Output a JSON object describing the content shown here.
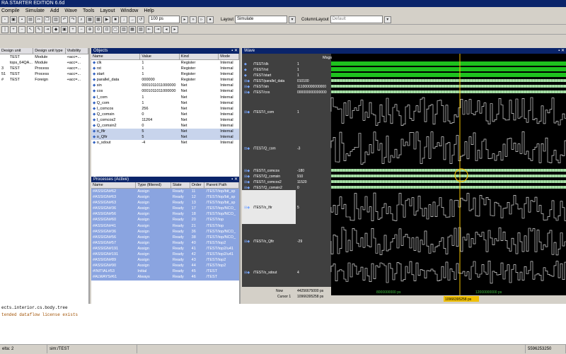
{
  "window": {
    "title": "RA STARTER EDITION 6.6d"
  },
  "menu": [
    "Compile",
    "Simulate",
    "Add",
    "Wave",
    "Tools",
    "Layout",
    "Window",
    "Help"
  ],
  "toolbar": {
    "sim_time": "100 ps",
    "layout_label": "Layout",
    "layout_value": "Simulate",
    "column_layout_label": "ColumnLayout",
    "column_layout_value": "Default"
  },
  "sim_panel": {
    "columns": [
      "Design unit",
      "Design unit type",
      "Visibility"
    ],
    "rows": [
      {
        "prefix": "",
        "unit": "TEST",
        "type": "Module",
        "vis": "+acc=..."
      },
      {
        "prefix": "",
        "unit": "tops_64QA...",
        "type": "Module",
        "vis": "+acc=..."
      },
      {
        "prefix": "3",
        "unit": "TEST",
        "type": "Process",
        "vis": "+acc=..."
      },
      {
        "prefix": "51",
        "unit": "TEST",
        "type": "Process",
        "vis": "+acc=..."
      },
      {
        "prefix": "#",
        "unit": "TEST",
        "type": "Foreign",
        "vis": "+acc=..."
      }
    ]
  },
  "objects": {
    "title": "Objects",
    "columns": [
      "Name",
      "Value",
      "Kind",
      "Mode"
    ],
    "rows": [
      {
        "name": "clk",
        "value": "1",
        "kind": "Register",
        "mode": "Internal"
      },
      {
        "name": "rst",
        "value": "1",
        "kind": "Register",
        "mode": "Internal"
      },
      {
        "name": "start",
        "value": "1",
        "kind": "Register",
        "mode": "Internal"
      },
      {
        "name": "parallel_data",
        "value": "000000",
        "kind": "Register",
        "mode": "Internal"
      },
      {
        "name": "sin",
        "value": "0001011011000000",
        "kind": "Net",
        "mode": "Internal"
      },
      {
        "name": "cos",
        "value": "0001011011000000",
        "kind": "Net",
        "mode": "Internal"
      },
      {
        "name": "I_com",
        "value": "1",
        "kind": "Net",
        "mode": "Internal"
      },
      {
        "name": "Q_com",
        "value": "1",
        "kind": "Net",
        "mode": "Internal"
      },
      {
        "name": "I_comcos",
        "value": "256",
        "kind": "Net",
        "mode": "Internal"
      },
      {
        "name": "Q_comsin",
        "value": "0",
        "kind": "Net",
        "mode": "Internal"
      },
      {
        "name": "I_comcos2",
        "value": "11264",
        "kind": "Net",
        "mode": "Internal"
      },
      {
        "name": "Q_comsin2",
        "value": "0",
        "kind": "Net",
        "mode": "Internal"
      },
      {
        "name": "o_Ifir",
        "value": "5",
        "kind": "Net",
        "mode": "Internal"
      },
      {
        "name": "o_Qfir",
        "value": "5",
        "kind": "Net",
        "mode": "Internal"
      },
      {
        "name": "o_sdout",
        "value": "-4",
        "kind": "Net",
        "mode": "Internal"
      }
    ]
  },
  "processes": {
    "title": "Processes (Active)",
    "columns": [
      "Name",
      "Type (filtered)",
      "State",
      "Order",
      "Parent Path"
    ],
    "rows": [
      {
        "name": "#ASSIGN#62",
        "type": "Assign",
        "state": "Ready",
        "order": "11",
        "path": "/TEST/top/bit_sp"
      },
      {
        "name": "#ASSIGN#63",
        "type": "Assign",
        "state": "Ready",
        "order": "12",
        "path": "/TEST/top/bit_sp"
      },
      {
        "name": "#ASSIGN#63",
        "type": "Assign",
        "state": "Ready",
        "order": "13",
        "path": "/TEST/top/bit_sp"
      },
      {
        "name": "#ASSIGN#36",
        "type": "Assign",
        "state": "Ready",
        "order": "17",
        "path": "/TEST/top/NCO_"
      },
      {
        "name": "#ASSIGN#56",
        "type": "Assign",
        "state": "Ready",
        "order": "18",
        "path": "/TEST/top/NCO_"
      },
      {
        "name": "#ASSIGN#60",
        "type": "Assign",
        "state": "Ready",
        "order": "20",
        "path": "/TEST/top"
      },
      {
        "name": "#ASSIGN#41",
        "type": "Assign",
        "state": "Ready",
        "order": "21",
        "path": "/TEST/top"
      },
      {
        "name": "#ASSIGN#36",
        "type": "Assign",
        "state": "Ready",
        "order": "36",
        "path": "/TEST/top/NCO_"
      },
      {
        "name": "#ASSIGN#56",
        "type": "Assign",
        "state": "Ready",
        "order": "38",
        "path": "/TEST/top/NCO_"
      },
      {
        "name": "#ASSIGN#57",
        "type": "Assign",
        "state": "Ready",
        "order": "40",
        "path": "/TEST/top2"
      },
      {
        "name": "#ASSIGN#191",
        "type": "Assign",
        "state": "Ready",
        "order": "41",
        "path": "/TEST/top2/u41"
      },
      {
        "name": "#ASSIGN#191",
        "type": "Assign",
        "state": "Ready",
        "order": "42",
        "path": "/TEST/top2/u41"
      },
      {
        "name": "#ASSIGN#89",
        "type": "Assign",
        "state": "Ready",
        "order": "43",
        "path": "/TEST/top2"
      },
      {
        "name": "#ASSIGN#90",
        "type": "Assign",
        "state": "Ready",
        "order": "44",
        "path": "/TEST/top2"
      },
      {
        "name": "#INITIAL#53",
        "type": "Initial",
        "state": "Ready",
        "order": "45",
        "path": "/TEST"
      },
      {
        "name": "#ALWAYS#61",
        "type": "Always",
        "state": "Ready",
        "order": "46",
        "path": "/TEST"
      }
    ]
  },
  "wave": {
    "title": "Wave",
    "msgs_label": "Msgs",
    "signals": [
      {
        "name": "/TEST/clk",
        "value": "1",
        "kind": "bit"
      },
      {
        "name": "/TEST/rst",
        "value": "1",
        "kind": "bit"
      },
      {
        "name": "/TEST/start",
        "value": "1",
        "kind": "bit"
      },
      {
        "name": "/TEST/parallel_data",
        "value": "010100",
        "kind": "bus"
      },
      {
        "name": "/TEST/sin",
        "value": "111000000000000",
        "kind": "bus"
      },
      {
        "name": "/TEST/cos",
        "value": "000000000000000",
        "kind": "bus"
      },
      {
        "name": "/TEST/I_com",
        "value": "1",
        "kind": "analog"
      },
      {
        "name": "/TEST/Q_com",
        "value": "-3",
        "kind": "analog"
      },
      {
        "name": "/TEST/I_comcos",
        "value": "-180",
        "kind": "bus"
      },
      {
        "name": "/TEST/Q_comsin",
        "value": "910",
        "kind": "bus"
      },
      {
        "name": "/TEST/I_comcos2",
        "value": "11520",
        "kind": "bus"
      },
      {
        "name": "/TEST/Q_comsin2",
        "value": "0",
        "kind": "bus"
      },
      {
        "name": "/TEST/o_Ifir",
        "value": "5",
        "kind": "analog"
      },
      {
        "name": "/TEST/o_Qfir",
        "value": "-29",
        "kind": "analog"
      },
      {
        "name": "/TEST/o_sdout",
        "value": "4",
        "kind": "analog"
      }
    ],
    "now_label": "Now",
    "now_value": "44256675000 ps",
    "cursor_label": "Cursor 1",
    "cursor_value": "10966395258 ps",
    "timeline_ticks": [
      "8000000000 ps",
      "12000000000 ps"
    ],
    "cursor_tag": "10966395258 ps"
  },
  "transcript": {
    "lines": [
      "ects.interior.cs.body.tree",
      "",
      "tended dataflow license exists"
    ]
  },
  "status": {
    "delta": "elta: 2",
    "sim": "sim:/TEST",
    "range": "5596253250"
  },
  "colors": {
    "title_bg": "#0a246a",
    "wave_green": "#1ec21e",
    "cursor": "#f0c000",
    "selected_row": "#8aa4e0"
  }
}
